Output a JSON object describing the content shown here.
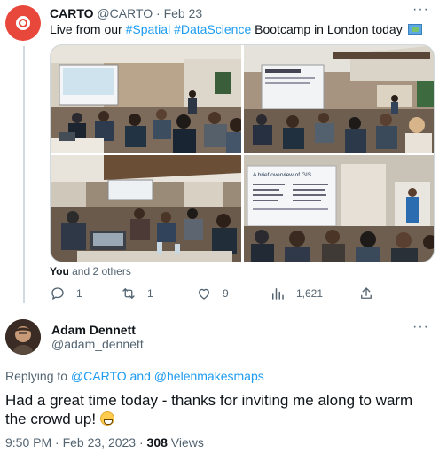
{
  "tweet": {
    "author_name": "CARTO",
    "author_handle": "@CARTO",
    "date": "Feb 23",
    "text_before": "Live from our ",
    "hashtag1": "#Spatial",
    "hashtag2": "#DataScience",
    "text_after": " Bootcamp in London today",
    "emoji": "world-map-emoji",
    "photos": [
      {
        "desc": "audience-with-presentation-screen"
      },
      {
        "desc": "audience-seated-at-tables"
      },
      {
        "desc": "room-with-laptops"
      },
      {
        "desc": "presenter-with-slide"
      }
    ],
    "slide_title": "A brief overview of GIS",
    "likes_prefix": "You",
    "likes_suffix": "and 2 others",
    "stats": {
      "replies": "1",
      "retweets": "1",
      "likes": "9",
      "views": "1,621"
    }
  },
  "reply": {
    "author_name": "Adam Dennett",
    "author_handle": "@adam_dennett",
    "replying_prefix": "Replying to ",
    "mention1": "@CARTO",
    "and_text": " and ",
    "mention2": "@helenmakesmaps",
    "text": "Had a great time today - thanks for inviting me along to warm the crowd up! ",
    "emoji": "grinning-face-emoji",
    "time": "9:50 PM · Feb 23, 2023 · ",
    "views_count": "308",
    "views_label": " Views"
  },
  "colors": {
    "accent": "#1d9bf0",
    "carto_red": "#e8473c",
    "secondary_text": "#536471"
  }
}
